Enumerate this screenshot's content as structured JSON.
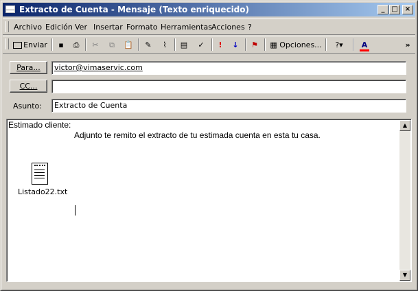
{
  "window": {
    "title": "Extracto de Cuenta - Mensaje (Texto enriquecido)"
  },
  "menu": [
    "Archivo",
    "Edición",
    "Ver",
    "Insertar",
    "Formato",
    "Herramientas",
    "Acciones",
    "?"
  ],
  "toolbar": {
    "send_label": "Enviar",
    "options_label": "Opciones..."
  },
  "header": {
    "to_button": "Para...",
    "to_value": "victor@vimaservic.com",
    "cc_button": "CC...",
    "cc_value": "",
    "subject_label": "Asunto:",
    "subject_value": "Extracto de Cuenta"
  },
  "message": {
    "greeting": "Estimado cliente:",
    "line1": "Adjunto te remito el extracto de tu estimada cuenta en esta tu casa.",
    "attachment_name": "Listado22.txt"
  },
  "colors": {
    "title_start": "#0a246a",
    "title_end": "#a6caf0",
    "font_color_bar": "#ff0000"
  }
}
